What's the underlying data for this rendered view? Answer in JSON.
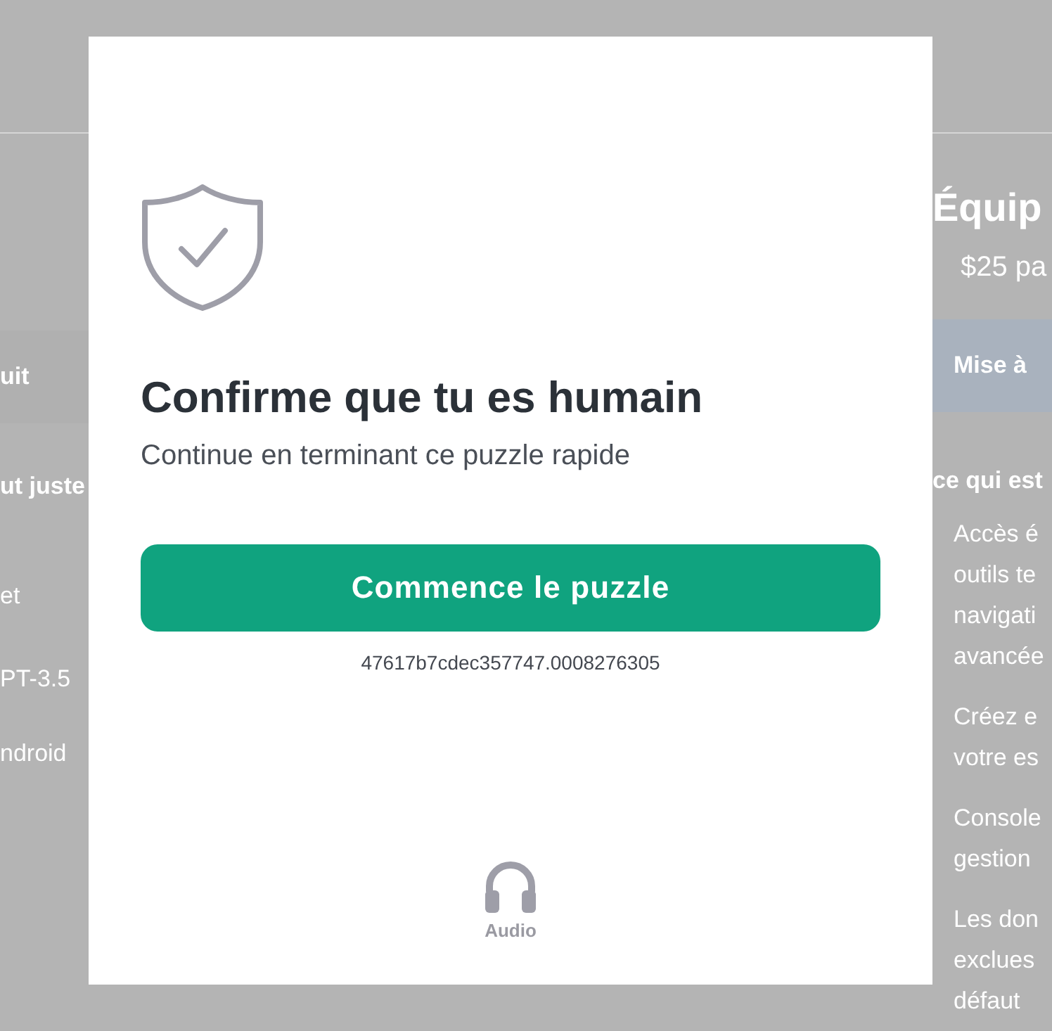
{
  "background_left": {
    "button": "uit",
    "heading": "ut juste",
    "items": [
      "et",
      "PT-3.5",
      "ndroid"
    ]
  },
  "background_right": {
    "title": "Équip",
    "price": "$25 pa",
    "button": "Mise à",
    "heading": "ce qui est",
    "items": [
      [
        "Accès é",
        "outils te",
        "navigati",
        "avancée"
      ],
      [
        "Créez e",
        "votre es"
      ],
      [
        "Console",
        "gestion"
      ],
      [
        "Les don",
        "exclues",
        "défaut"
      ]
    ]
  },
  "dialog": {
    "title": "Confirme que tu es humain",
    "subtitle": "Continue en terminant ce puzzle rapide",
    "button": "Commence le puzzle",
    "session_id": "47617b7cdec357747.0008276305",
    "audio_label": "Audio"
  }
}
